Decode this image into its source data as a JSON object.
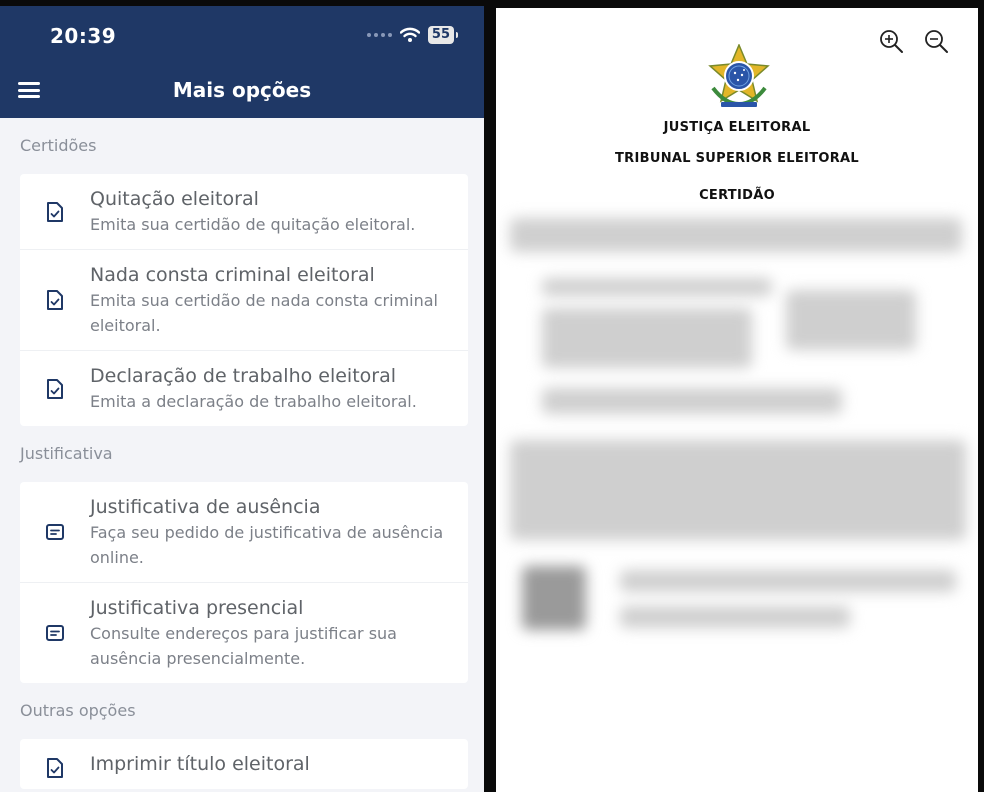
{
  "status_bar": {
    "time": "20:39",
    "battery": "55"
  },
  "header": {
    "title": "Mais opções"
  },
  "sections": [
    {
      "title": "Certidões",
      "items": [
        {
          "title": "Quitação eleitoral",
          "desc": "Emita sua certidão de quitação eleitoral.",
          "icon": "document-check-icon"
        },
        {
          "title": "Nada consta criminal eleitoral",
          "desc": "Emita sua certidão de nada consta criminal eleitoral.",
          "icon": "document-check-icon"
        },
        {
          "title": "Declaração de trabalho eleitoral",
          "desc": "Emita a declaração de trabalho eleitoral.",
          "icon": "document-check-icon"
        }
      ]
    },
    {
      "title": "Justificativa",
      "items": [
        {
          "title": "Justificativa de ausência",
          "desc": "Faça seu pedido de justificativa de ausência online.",
          "icon": "message-icon"
        },
        {
          "title": "Justificativa presencial",
          "desc": "Consulte endereços para justificar sua ausência presencialmente.",
          "icon": "message-icon"
        }
      ]
    },
    {
      "title": "Outras opções",
      "items": [
        {
          "title": "Imprimir título eleitoral",
          "desc": "",
          "icon": "document-check-icon"
        }
      ]
    }
  ],
  "document": {
    "line1": "JUSTIÇA ELEITORAL",
    "line2": "TRIBUNAL SUPERIOR ELEITORAL",
    "line3": "CERTIDÃO"
  },
  "colors": {
    "header": "#1f3866",
    "accent": "#1f3866",
    "background": "#f3f4f8"
  }
}
